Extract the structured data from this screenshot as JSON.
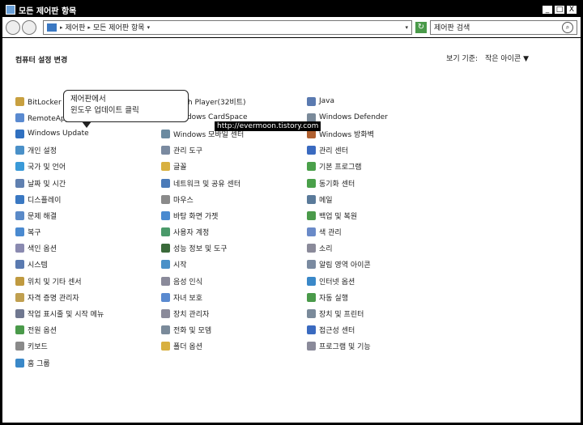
{
  "window": {
    "title": "모든 제어판 항목",
    "min": "_",
    "max": "□",
    "close": "X"
  },
  "addressbar": {
    "crumbs": [
      "제어판",
      "모든 제어판 항목"
    ]
  },
  "search": {
    "placeholder": "제어판 검색"
  },
  "page": {
    "heading": "컴퓨터 설정 변경",
    "view_by_label": "보기 기준:",
    "view_by_value": "작은 아이콘 ▼"
  },
  "callout": {
    "line1": "제어판에서",
    "line2": "윈도우 업데이트 클릭"
  },
  "watermark": "http://evermoon.tistory.com",
  "items": {
    "col1": [
      {
        "label": "BitLocker 드",
        "color": "#c8a040"
      },
      {
        "label": "RemoteApp 및 데스크톱 연결",
        "color": "#5a8ad0"
      },
      {
        "label": "Windows Update",
        "color": "#3070c0"
      },
      {
        "label": "개인 설정",
        "color": "#4a90c8"
      },
      {
        "label": "국가 및 언어",
        "color": "#3a9ad8"
      },
      {
        "label": "날짜 및 시간",
        "color": "#6080b0"
      },
      {
        "label": "디스플레이",
        "color": "#3a78c2"
      },
      {
        "label": "문제 해결",
        "color": "#5a8ac8"
      },
      {
        "label": "복구",
        "color": "#4a8ad0"
      },
      {
        "label": "색인 옵션",
        "color": "#8a8ab0"
      },
      {
        "label": "시스템",
        "color": "#5a7ab0"
      },
      {
        "label": "위치 및 기타 센서",
        "color": "#c09a40"
      },
      {
        "label": "자격 증명 관리자",
        "color": "#c0a050"
      },
      {
        "label": "작업 표시줄 및 시작 메뉴",
        "color": "#707890"
      },
      {
        "label": "전원 옵션",
        "color": "#4a9a4a"
      },
      {
        "label": "키보드",
        "color": "#8a8a8a"
      },
      {
        "label": "홈 그룹",
        "color": "#3a88c8"
      }
    ],
    "col2": [
      {
        "label": "Flash Player(32비트)",
        "color": "#c03030"
      },
      {
        "label": "Windows CardSpace",
        "color": "#5a7ac0"
      },
      {
        "label": "Windows 모바일 센터",
        "color": "#6a8aa0"
      },
      {
        "label": "관리 도구",
        "color": "#7a8aa0"
      },
      {
        "label": "글꼴",
        "color": "#d8b040"
      },
      {
        "label": "네트워크 및 공유 센터",
        "color": "#4a7ab8"
      },
      {
        "label": "마우스",
        "color": "#8a8a8a"
      },
      {
        "label": "바탕 화면 가젯",
        "color": "#4a8ad0"
      },
      {
        "label": "사용자 계정",
        "color": "#4a9a6a"
      },
      {
        "label": "성능 정보 및 도구",
        "color": "#3a6a3a"
      },
      {
        "label": "시작",
        "color": "#4a90c8"
      },
      {
        "label": "음성 인식",
        "color": "#8a8a9a"
      },
      {
        "label": "자녀 보호",
        "color": "#5a8ad0"
      },
      {
        "label": "장치 관리자",
        "color": "#8a8a9a"
      },
      {
        "label": "전화 및 모뎀",
        "color": "#7a8a9a"
      },
      {
        "label": "폴더 옵션",
        "color": "#d8b040"
      }
    ],
    "col3": [
      {
        "label": "Java",
        "color": "#5a7ab0"
      },
      {
        "label": "Windows Defender",
        "color": "#7a8a9a"
      },
      {
        "label": "Windows 방화벽",
        "color": "#b06030"
      },
      {
        "label": "관리 센터",
        "color": "#3a6ac0"
      },
      {
        "label": "기본 프로그램",
        "color": "#4aa04a"
      },
      {
        "label": "동기화 센터",
        "color": "#4aa04a"
      },
      {
        "label": "메일",
        "color": "#5a7a9a"
      },
      {
        "label": "백업 및 복원",
        "color": "#4a9a4a"
      },
      {
        "label": "색 관리",
        "color": "#6a8ac8"
      },
      {
        "label": "소리",
        "color": "#8a8a9a"
      },
      {
        "label": "알림 영역 아이콘",
        "color": "#7a8aa0"
      },
      {
        "label": "인터넷 옵션",
        "color": "#3a88c8"
      },
      {
        "label": "자동 실행",
        "color": "#4a9a4a"
      },
      {
        "label": "장치 및 프린터",
        "color": "#7a8a9a"
      },
      {
        "label": "접근성 센터",
        "color": "#3a6ac0"
      },
      {
        "label": "프로그램 및 기능",
        "color": "#8a8a9a"
      }
    ]
  }
}
